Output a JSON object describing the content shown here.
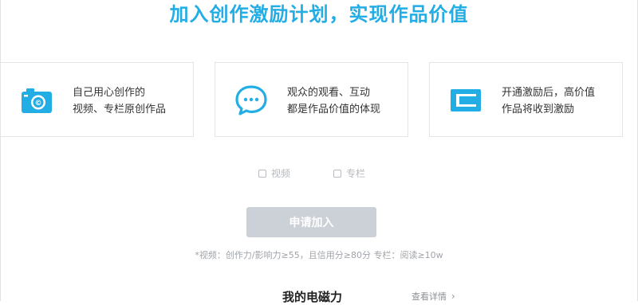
{
  "headline": "加入创作激励计划，实现作品价值",
  "cards": [
    {
      "line1": "自己用心创作的",
      "line2": "视频、专栏原创作品"
    },
    {
      "line1": "观众的观看、互动",
      "line2": "都是作品价值的体现"
    },
    {
      "line1": "开通激励后，高价值",
      "line2": "作品将收到激励"
    }
  ],
  "options": [
    {
      "label": "视频",
      "checked": false
    },
    {
      "label": "专栏",
      "checked": false
    }
  ],
  "apply_button": "申请加入",
  "note": "*视频：创作力/影响力≥55，且信用分≥80分 专栏：阅读≥10w",
  "power_title": "我的电磁力",
  "details_link": "查看详情",
  "colors": {
    "accent": "#23ade5",
    "disabled_button": "#ccd0d7"
  }
}
